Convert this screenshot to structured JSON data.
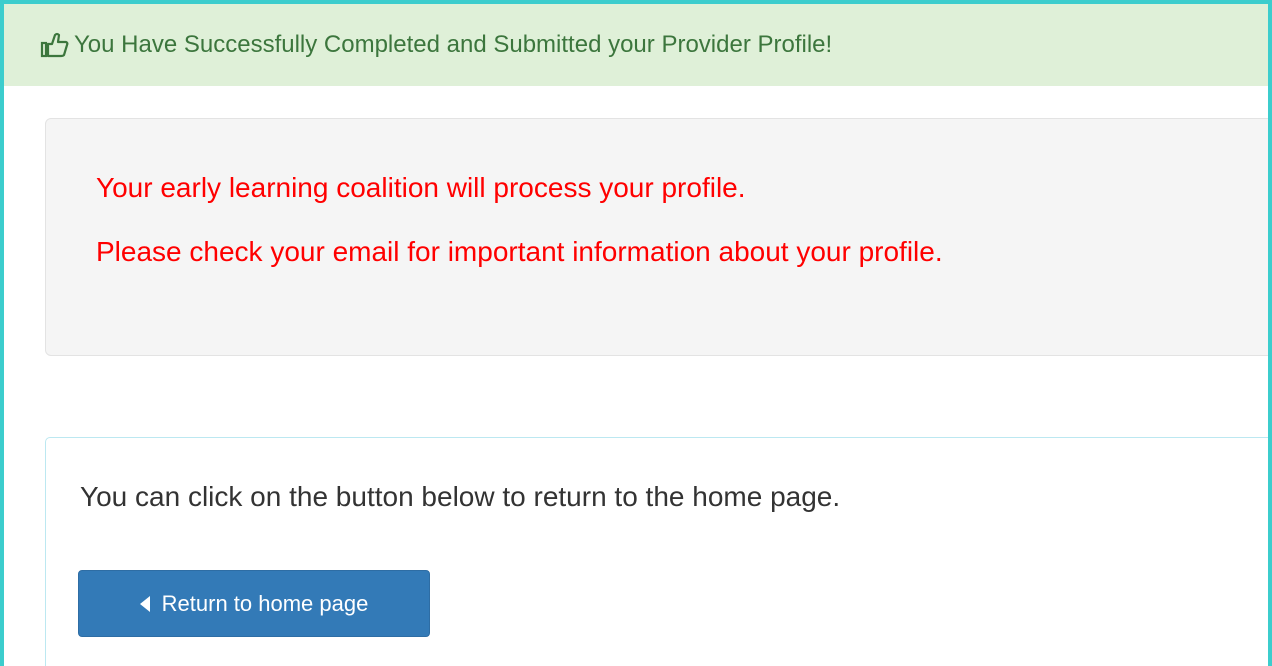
{
  "banner": {
    "icon": "thumbs-up-icon",
    "message": "You Have Successfully Completed and Submitted your Provider Profile!",
    "background_color": "#dff0d8",
    "text_color": "#3c763d"
  },
  "info": {
    "lines": [
      "Your early learning coalition will process your profile.",
      "Please check your email for important information about your profile."
    ],
    "text_color": "#ff0000"
  },
  "return_panel": {
    "text": "You can click on the button below to return to the home page.",
    "button": {
      "icon": "caret-left-icon",
      "label": "Return to home page",
      "color": "#337ab7"
    }
  }
}
